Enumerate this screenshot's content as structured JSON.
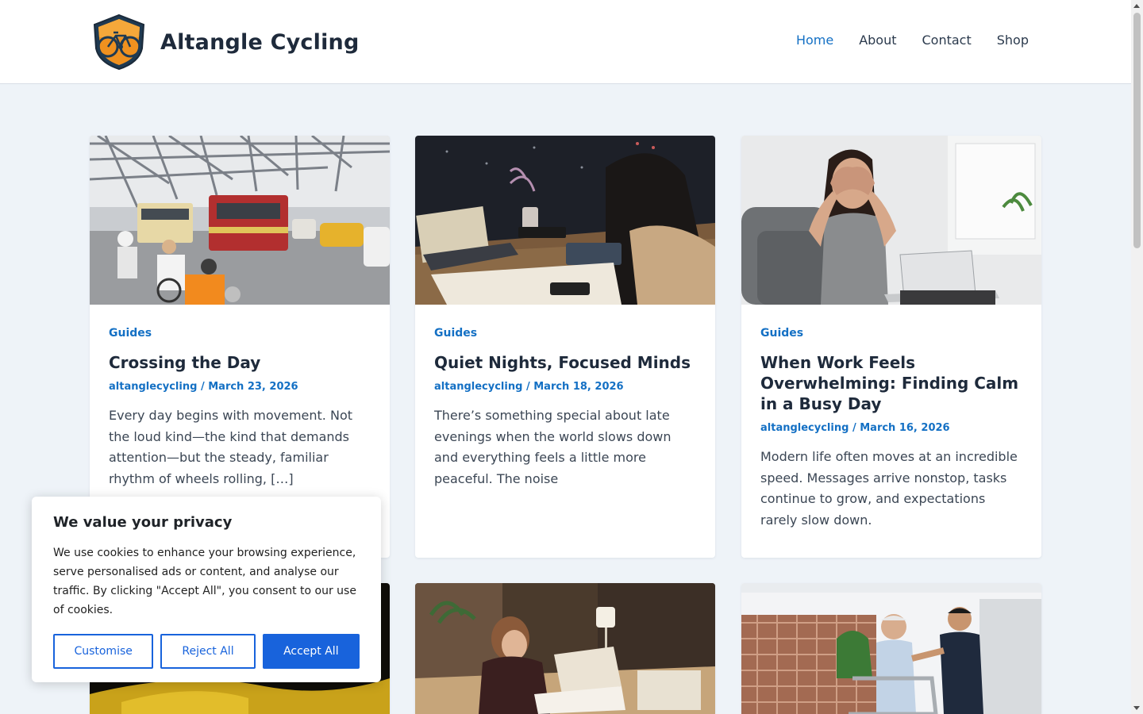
{
  "site": {
    "title": "Altangle Cycling",
    "logo_icon": "bicycle-shield-logo-icon"
  },
  "nav": {
    "items": [
      {
        "label": "Home",
        "active": true
      },
      {
        "label": "About"
      },
      {
        "label": "Contact"
      },
      {
        "label": "Shop"
      }
    ]
  },
  "posts": [
    {
      "image": "bridge-traffic-photo",
      "category": "Guides",
      "title": "Crossing the Day",
      "author": "altanglecycling",
      "date": "March 23, 2026",
      "excerpt": "Every day begins with movement. Not the loud kind—the kind that demands attention—but the steady, familiar rhythm of wheels rolling, […]"
    },
    {
      "image": "woman-studying-at-night-photo",
      "category": "Guides",
      "title": "Quiet Nights, Focused Minds",
      "author": "altanglecycling",
      "date": "March 18, 2026",
      "excerpt": "There’s something special about late evenings when the world slows down and everything feels a little more peaceful. The noise"
    },
    {
      "image": "stressed-woman-laptop-photo",
      "category": "Guides",
      "title": "When Work Feels Overwhelming: Finding Calm in a Busy Day",
      "author": "altanglecycling",
      "date": "March 16, 2026",
      "excerpt": "Modern life often moves at an incredible speed. Messages arrive nonstop, tasks continue to grow, and expectations rarely slow down."
    },
    {
      "image": "yellow-fabric-photo"
    },
    {
      "image": "woman-working-at-desk-photo"
    },
    {
      "image": "elderly-man-walker-photo"
    }
  ],
  "meta_separator": " / ",
  "cookie": {
    "heading": "We value your privacy",
    "text": "We use cookies to enhance your browsing experience, serve personalised ads or content, and analyse our traffic. By clicking \"Accept All\", you consent to our use of cookies.",
    "customise": "Customise",
    "reject": "Reject All",
    "accept": "Accept All"
  },
  "colors": {
    "accent": "#1470c4",
    "cookie_button": "#1863dc",
    "background": "#eef3f8"
  }
}
